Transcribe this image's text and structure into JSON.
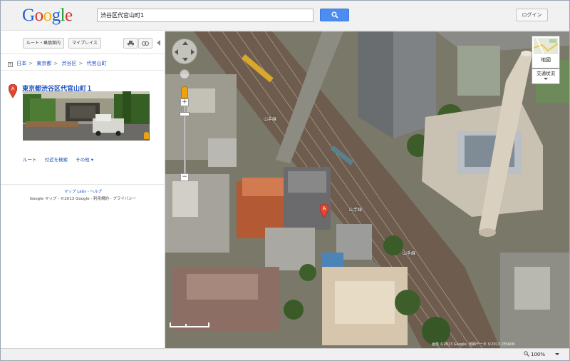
{
  "header": {
    "logo_text": "Google",
    "search_value": "渋谷区代官山町1",
    "login_label": "ログイン"
  },
  "panel": {
    "route_label": "ルート・乗換案内",
    "myplaces_label": "マイプレイス",
    "breadcrumb": [
      "日本",
      "東京都",
      "渋谷区",
      "代官山町"
    ],
    "result_title": "東京都渋谷区代官山町１",
    "result_marker": "A",
    "actions": [
      "ルート",
      "付近を検索",
      "その他 ▾"
    ],
    "footer_labs": "マップ Labs - ヘルプ",
    "footer_copy": "Google マップ - ©2013 Google - 利用規約 - プライバシー"
  },
  "map": {
    "maptype_label": "地図",
    "traffic_label": "交通状況",
    "marker_label": "A",
    "copyright": "画像 ©2013 Google, 地図データ ©2013 ZENRIN",
    "street_labels": [
      "山手線",
      "山手線",
      "山手線"
    ]
  },
  "status": {
    "zoom": "100%"
  },
  "colors": {
    "link": "#1a4fc0",
    "search_button": "#4b8df0",
    "marker": "#e2442f"
  }
}
